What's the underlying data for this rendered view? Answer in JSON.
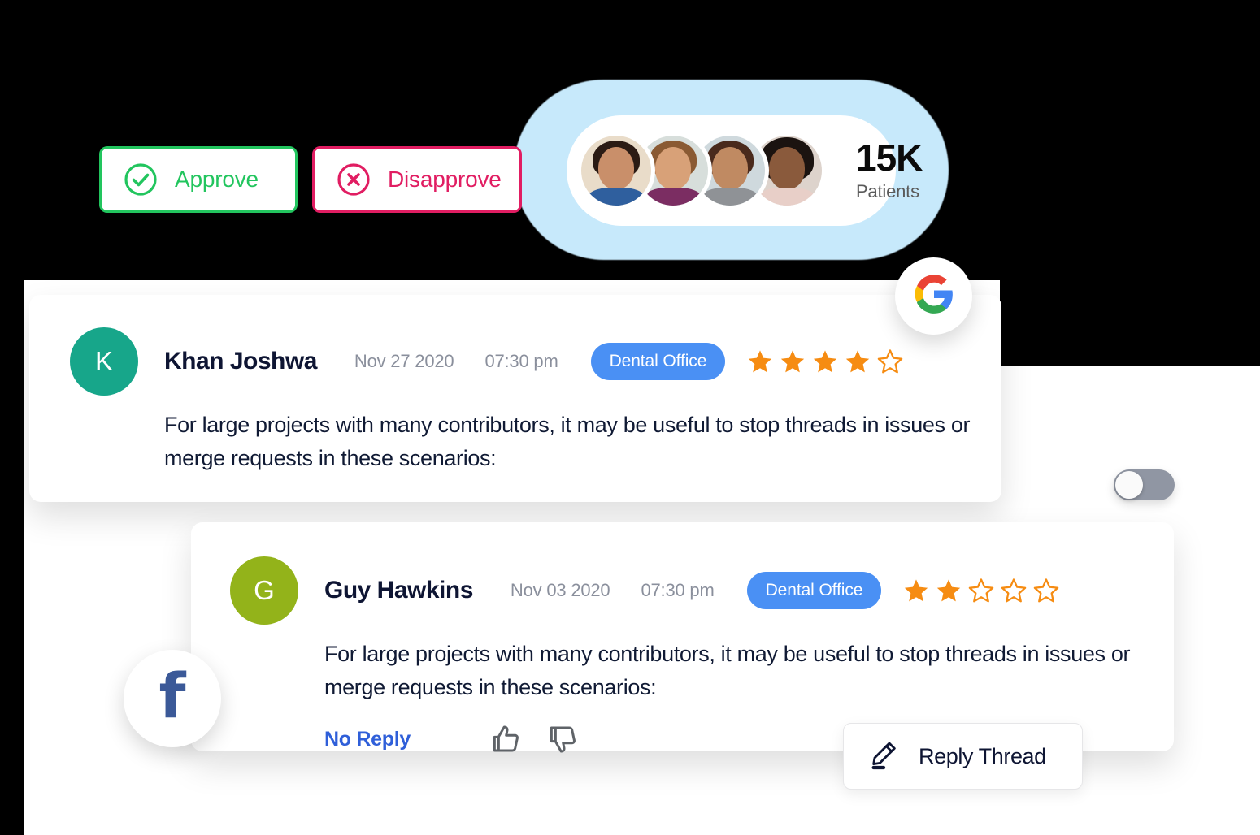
{
  "actions": {
    "approve": {
      "label": "Approve",
      "icon": "check-circle-icon",
      "color": "#22c55e"
    },
    "disapprove": {
      "label": "Disapprove",
      "icon": "x-circle-icon",
      "color": "#e11d62"
    }
  },
  "patients_badge": {
    "count": "15K",
    "label": "Patients",
    "glow_color": "#c7e9fb",
    "avatar_count": 4,
    "avatars": [
      {
        "name": "patient-avatar-1",
        "skin": "#c98f6a",
        "hair": "#2b1b14",
        "top": "#2f5f9e"
      },
      {
        "name": "patient-avatar-2",
        "skin": "#d8a178",
        "hair": "#8a5a33",
        "top": "#7b2d62"
      },
      {
        "name": "patient-avatar-3",
        "skin": "#c08a62",
        "hair": "#4a2a1c",
        "top": "#8f9296"
      },
      {
        "name": "patient-avatar-4",
        "skin": "#8a5a3c",
        "hair": "#1b1310",
        "top": "#e8cfc8"
      }
    ]
  },
  "social": {
    "google_label": "G",
    "facebook_label": "f",
    "google_colors": {
      "red": "#ea4335",
      "yellow": "#fbbc05",
      "green": "#34a853",
      "blue": "#4285f4"
    },
    "facebook_color": "#3b5998"
  },
  "toggle": {
    "state": "off",
    "track_color": "#9096a3",
    "knob_color": "#fafafa"
  },
  "star_colors": {
    "filled": "#f68c12",
    "empty_stroke": "#f68c12"
  },
  "reviews": [
    {
      "id": "review-khan-joshwa",
      "initial": "K",
      "avatar_color": "#17a68a",
      "name": "Khan Joshwa",
      "date": "Nov 27 2020",
      "time": "07:30 pm",
      "tag": "Dental Office",
      "tag_color": "#4a90f4",
      "rating": 4,
      "max_rating": 5,
      "body": "For large projects with many contributors, it may be useful to stop threads in issues or merge requests in these scenarios:",
      "has_actions": false
    },
    {
      "id": "review-guy-hawkins",
      "initial": "G",
      "avatar_color": "#93b31a",
      "name": "Guy Hawkins",
      "date": "Nov 03 2020",
      "time": "07:30 pm",
      "tag": "Dental Office",
      "tag_color": "#4a90f4",
      "rating": 2,
      "max_rating": 5,
      "body": "For large projects with many contributors, it may be useful to stop threads in issues or merge requests in these scenarios:",
      "has_actions": true,
      "reply_status": "No Reply",
      "thumbs_up_icon": "thumbs-up-icon",
      "thumbs_down_icon": "thumbs-down-icon"
    }
  ],
  "reply_thread_button": {
    "label": "Reply Thread",
    "icon": "pencil-icon"
  }
}
